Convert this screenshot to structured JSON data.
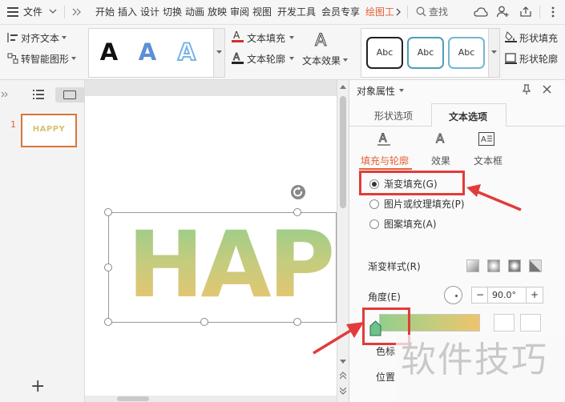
{
  "menubar": {
    "file_label": "文件",
    "tabs": [
      "开始",
      "插入",
      "设计",
      "切换",
      "动画",
      "放映",
      "审阅",
      "视图",
      "开发工具",
      "会员专享",
      "绘图工"
    ],
    "search_label": "查找"
  },
  "ribbon": {
    "align_text": "对齐文本",
    "smart_shape": "转智能图形",
    "text_fill": "文本填充",
    "text_outline": "文本轮廓",
    "text_effect": "文本效果",
    "shape_fill": "形状填充",
    "shape_outline": "形状轮廓",
    "art_glyph": "A",
    "shape_style_sample": "Abc"
  },
  "thumbs": {
    "slide_number": "1",
    "slide_text": "HAPPY",
    "add_glyph": "+"
  },
  "canvas": {
    "text": "HAP"
  },
  "props": {
    "title": "对象属性",
    "tab_shape": "形状选项",
    "tab_text": "文本选项",
    "sub_fill_outline": "填充与轮廓",
    "sub_effect": "效果",
    "sub_textbox": "文本框",
    "opt_gradient": "渐变填充(G)",
    "opt_picture": "图片或纹理填充(P)",
    "opt_pattern": "图案填充(A)",
    "gradient_style_label": "渐变样式(R)",
    "angle_label": "角度(E)",
    "angle_value": "90.0°",
    "minus": "−",
    "plus": "+",
    "color_stop_label": "色标",
    "position_label": "位置"
  },
  "watermark": "软件技巧",
  "colors": {
    "accent": "#e56035",
    "annotation_red": "#e23b3b",
    "gradient_top": "#93ce8b",
    "gradient_bottom": "#efc46c"
  }
}
